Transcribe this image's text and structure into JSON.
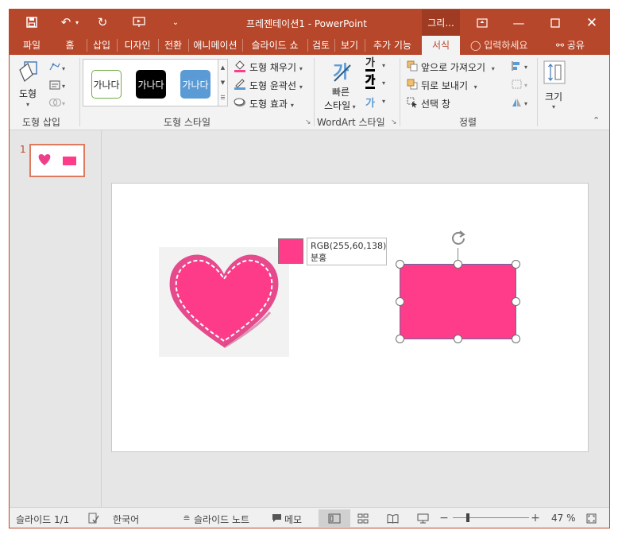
{
  "title": "프레젠테이션1 - PowerPoint",
  "context_tab": "그리...",
  "tabs": [
    "파일",
    "홈",
    "삽입",
    "디자인",
    "전환",
    "애니메이션",
    "슬라이드 쇼",
    "검토",
    "보기",
    "추가 기능",
    "서식"
  ],
  "active_tab": "서식",
  "tell_me": "입력하세요",
  "share": "공유",
  "ribbon": {
    "insert_shapes": {
      "shape_label": "도형",
      "group_label": "도형 삽입"
    },
    "shape_styles": {
      "gallery": [
        "가나다",
        "가나다",
        "가나다"
      ],
      "fill": "도형 채우기",
      "outline": "도형 윤곽선",
      "effects": "도형 효과",
      "group_label": "도형 스타일"
    },
    "wordart": {
      "quick_styles_line1": "빠른",
      "quick_styles_line2": "스타일",
      "group_label": "WordArt 스타일",
      "glyph": "가"
    },
    "arrange": {
      "bring_forward": "앞으로 가져오기",
      "send_backward": "뒤로 보내기",
      "selection_pane": "선택 창",
      "group_label": "정렬"
    },
    "size": {
      "label": "크기"
    }
  },
  "thumbnails": [
    {
      "number": "1"
    }
  ],
  "color_tooltip": {
    "rgb": "RGB(255,60,138)",
    "name": "분홍",
    "color": "#ff3c8a"
  },
  "colors": {
    "accent": "#b7472a",
    "shape_fill": "#ff3c8a",
    "heart": "#ee3f8a"
  },
  "status": {
    "slide": "슬라이드 1/1",
    "language": "한국어",
    "notes": "슬라이드 노트",
    "comments": "메모",
    "zoom": "47 %"
  }
}
